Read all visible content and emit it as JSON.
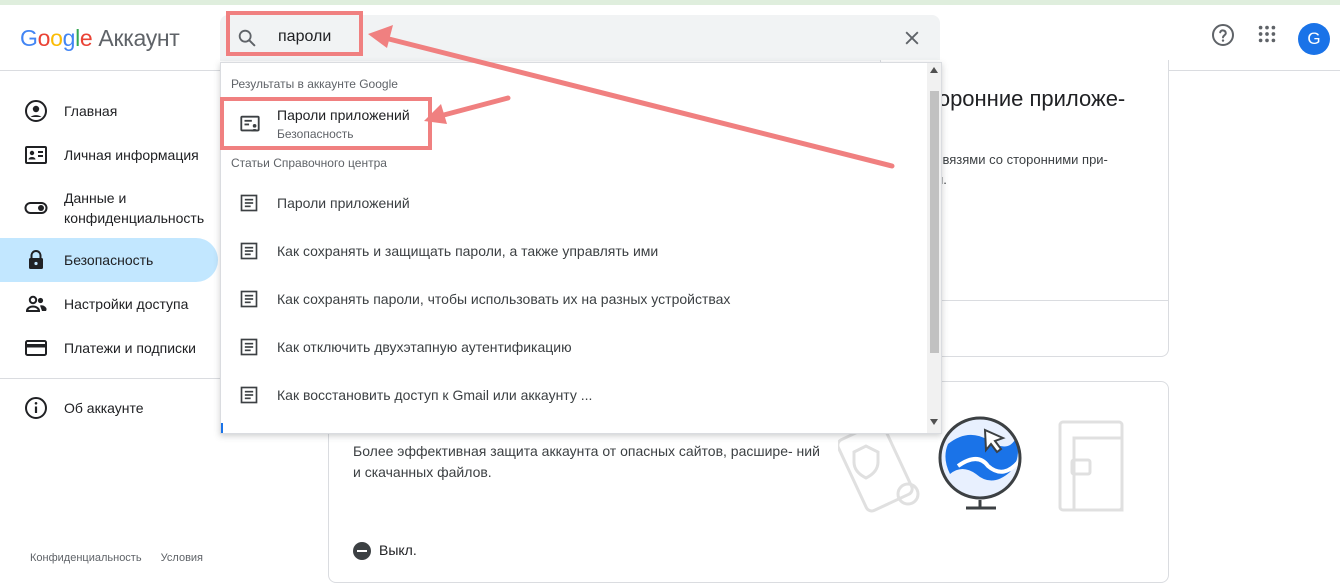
{
  "header": {
    "logo_google": "Google",
    "logo_product": "Аккаунт",
    "avatar_letter": "G"
  },
  "search": {
    "value": "пароли"
  },
  "sidebar": {
    "items": [
      {
        "label": "Главная",
        "icon": "account-circle-icon"
      },
      {
        "label": "Личная информация",
        "icon": "id-card-icon"
      },
      {
        "label": "Данные и конфиденциальность",
        "icon": "toggle-icon"
      },
      {
        "label": "Безопасность",
        "icon": "lock-icon"
      },
      {
        "label": "Настройки доступа",
        "icon": "people-icon"
      },
      {
        "label": "Платежи и подписки",
        "icon": "credit-card-icon"
      },
      {
        "label": "Об аккаунте",
        "icon": "info-icon"
      }
    ],
    "footer": [
      "Конфиденциальность",
      "Условия"
    ]
  },
  "dropdown": {
    "section_account": "Результаты в аккаунте Google",
    "account_result": {
      "title": "Пароли приложений",
      "subtitle": "Безопасность"
    },
    "section_help": "Статьи Справочного центра",
    "help_results": [
      "Пароли приложений",
      "Как сохранять и защищать пароли, а также управлять ими",
      "Как сохранять пароли, чтобы использовать их на разных устройствах",
      "Как отключить двухэтапную аутентификацию",
      "Как восстановить доступ к Gmail или аккаунту ..."
    ]
  },
  "background": {
    "card1_title": "торонние приложе-",
    "card1_text_line1": "связями со сторонними при-",
    "card1_text_line2": "и.",
    "card2_text": "Более эффективная защита аккаунта от опасных сайтов, расшире- ний и скачанных файлов.",
    "off_label": "Выкл."
  },
  "colors": {
    "accent": "#1a73e8",
    "active_nav": "#c2e7ff",
    "annotation": "#f08080"
  }
}
